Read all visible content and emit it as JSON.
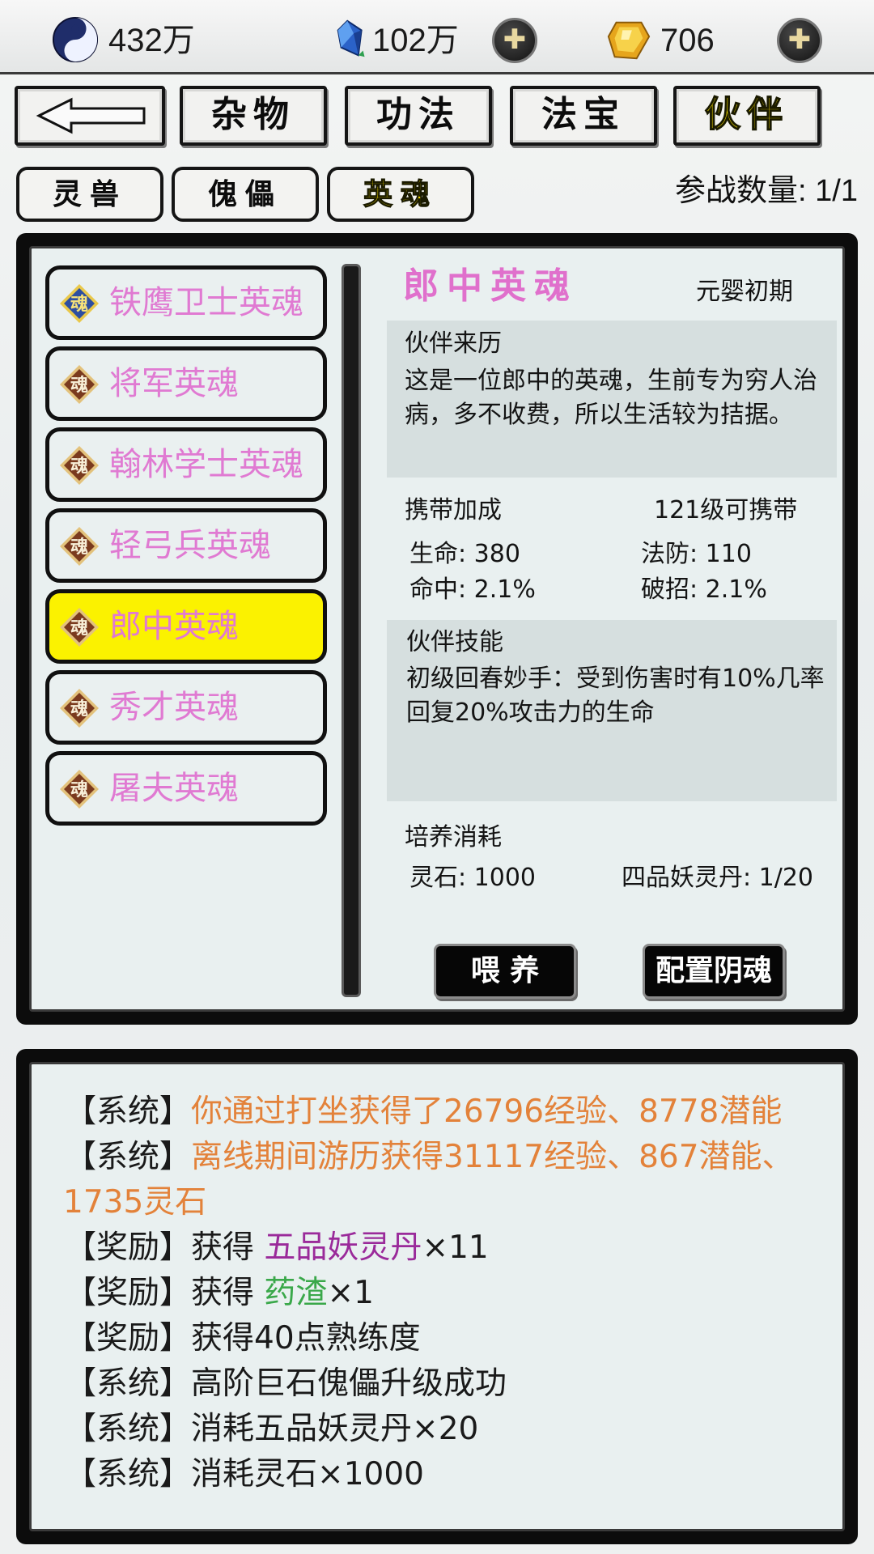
{
  "resources": {
    "spirit_qi": "432万",
    "gem": "102万",
    "gold": "706"
  },
  "main_tabs": [
    {
      "label": "杂物",
      "active": false
    },
    {
      "label": "功法",
      "active": false
    },
    {
      "label": "法宝",
      "active": false
    },
    {
      "label": "伙伴",
      "active": true
    }
  ],
  "sub_tabs": [
    {
      "label": "灵兽",
      "active": false
    },
    {
      "label": "傀儡",
      "active": false
    },
    {
      "label": "英魂",
      "active": true
    }
  ],
  "battle_count": "参战数量: 1/1",
  "icons": {
    "back": "back-arrow-icon",
    "soul": "soul-badge-icon",
    "plus": "plus-icon",
    "spirit_qi": "yin-yang-icon",
    "gem": "blue-crystal-icon",
    "gold": "gold-ingot-icon"
  },
  "companions": [
    {
      "name": "铁鹰卫士英魂",
      "badge_glyph": "魂",
      "badge_color": "#2d4ea0",
      "selected": false
    },
    {
      "name": "将军英魂",
      "badge_glyph": "魂",
      "badge_color": "#7a3a1e",
      "selected": false
    },
    {
      "name": "翰林学士英魂",
      "badge_glyph": "魂",
      "badge_color": "#7a3a1e",
      "selected": false
    },
    {
      "name": "轻弓兵英魂",
      "badge_glyph": "魂",
      "badge_color": "#7a3a1e",
      "selected": false
    },
    {
      "name": "郎中英魂",
      "badge_glyph": "魂",
      "badge_color": "#7a3a1e",
      "selected": true
    },
    {
      "name": "秀才英魂",
      "badge_glyph": "魂",
      "badge_color": "#7a3a1e",
      "selected": false
    },
    {
      "name": "屠夫英魂",
      "badge_glyph": "魂",
      "badge_color": "#7a3a1e",
      "selected": false
    }
  ],
  "detail": {
    "name": "郎中英魂",
    "realm": "元婴初期",
    "origin_title": "伙伴来历",
    "origin_text": "这是一位郎中的英魂，生前专为穷人治病，多不收费，所以生活较为拮据。",
    "bonus_title": "携带加成",
    "carry_level": "121级可携带",
    "stats": {
      "hp": "生命: 380",
      "mdef": "法防: 110",
      "hit": "命中: 2.1%",
      "pierce": "破招: 2.1%"
    },
    "skill_title": "伙伴技能",
    "skill_text": "初级回春妙手：受到伤害时有10%几率回复20%攻击力的生命",
    "cost_title": "培养消耗",
    "cost_stone": "灵石: 1000",
    "cost_pill": "四品妖灵丹: 1/20",
    "feed_button": "喂 养",
    "config_button": "配置阴魂"
  },
  "log": [
    {
      "tag": "【系统】",
      "text": "你通过打坐获得了26796经验、8778潜能"
    },
    {
      "tag": "【系统】",
      "text": "离线期间游历获得31117经验、867潜能、1735灵石"
    },
    {
      "tag": "【奖励】",
      "prefix": "获得 ",
      "item": "五品妖灵丹",
      "suffix": "×11"
    },
    {
      "tag": "【奖励】",
      "prefix": "获得 ",
      "item": "药渣",
      "suffix": "×1"
    },
    {
      "tag": "【奖励】",
      "text": "获得40点熟练度"
    },
    {
      "tag": "【系统】",
      "text": "高阶巨石傀儡升级成功"
    },
    {
      "tag": "【系统】",
      "text": "消耗五品妖灵丹×20"
    },
    {
      "tag": "【系统】",
      "text": "消耗灵石×1000"
    }
  ]
}
